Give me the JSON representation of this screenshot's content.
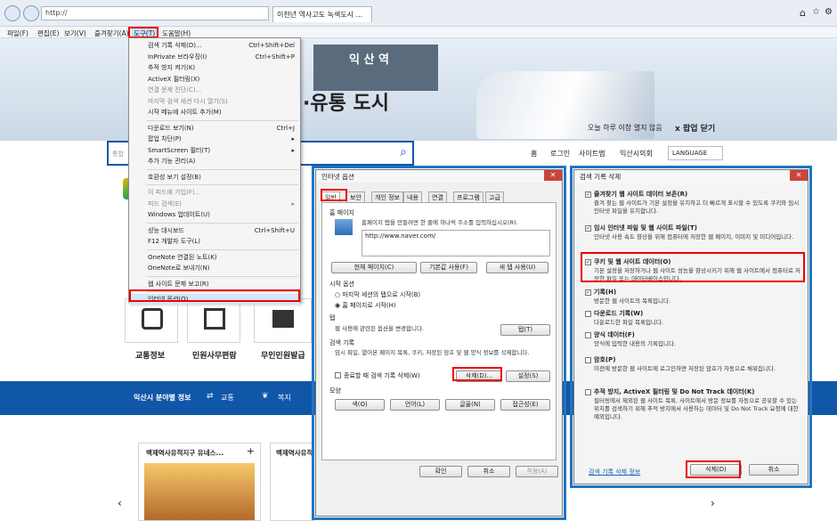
{
  "browser": {
    "address": "http://",
    "tab_title": "이천년 역사고도 녹색도시 ...",
    "menu": [
      "파일(F)",
      "편집(E)",
      "보기(V)",
      "즐겨찾기(A)",
      "도구(T)",
      "도움말(H)"
    ]
  },
  "tools_menu": {
    "items": [
      {
        "label": "검색 기록 삭제(D)...",
        "shortcut": "Ctrl+Shift+Del"
      },
      {
        "label": "InPrivate 브라우징(I)",
        "shortcut": "Ctrl+Shift+P"
      },
      {
        "label": "추적 방지 켜기(K)",
        "shortcut": ""
      },
      {
        "label": "ActiveX 필터링(X)",
        "shortcut": ""
      },
      {
        "label": "연결 문제 진단(C)...",
        "shortcut": ""
      },
      {
        "label": "마지막 검색 세션 다시 열기(S)",
        "shortcut": ""
      },
      {
        "label": "시작 메뉴에 사이트 추가(M)",
        "shortcut": ""
      },
      {
        "label": "다운로드 보기(N)",
        "shortcut": "Ctrl+J"
      },
      {
        "label": "팝업 차단(P)",
        "shortcut": "▸"
      },
      {
        "label": "SmartScreen 필터(T)",
        "shortcut": "▸"
      },
      {
        "label": "추가 기능 관리(A)",
        "shortcut": ""
      },
      {
        "label": "호환성 보기 설정(B)",
        "shortcut": ""
      },
      {
        "label": "이 피드에 가입(F)...",
        "shortcut": ""
      },
      {
        "label": "피드 검색(E)",
        "shortcut": "▸"
      },
      {
        "label": "Windows 업데이트(U)",
        "shortcut": ""
      },
      {
        "label": "성능 대시보드",
        "shortcut": "Ctrl+Shift+U"
      },
      {
        "label": "F12 개발자 도구(L)",
        "shortcut": ""
      },
      {
        "label": "OneNote 연결된 노트(K)",
        "shortcut": ""
      },
      {
        "label": "OneNote로 보내기(N)",
        "shortcut": ""
      },
      {
        "label": "웹 사이트 문제 보고(R)",
        "shortcut": ""
      },
      {
        "label": "인터넷 옵션(O)",
        "shortcut": ""
      }
    ]
  },
  "site": {
    "station_name": "익 산 역",
    "banner_text": "·유통 도시",
    "search_placeholder": "통합",
    "popup_option": "오늘 하루 이창 열지 않음",
    "popup_close": "x 팝업 닫기",
    "topnav": [
      "홈",
      "로그인",
      "사이트맵",
      "익산시의회"
    ],
    "language": "LANGUAGE",
    "quick_links": [
      "교통정보",
      "민원사무편람",
      "무인민원발급"
    ],
    "band_title": "익산시 분야별 정보",
    "band_items": [
      "교통",
      "복지"
    ],
    "card_titles": [
      "백제역사유적지구 유네스...",
      "백제역사유적지구 유네스..."
    ]
  },
  "internet_options": {
    "title": "인터넷 옵션",
    "tabs": [
      "일반",
      "보안",
      "개인 정보",
      "내용",
      "연결",
      "프로그램",
      "고급"
    ],
    "home_section": "홈 페이지",
    "home_desc": "홈페이지 탭을 만들려면 한 줄에 하나씩 주소를 입력하십시오(R).",
    "home_url": "http://www.naver.com/",
    "home_buttons": [
      "현재 페이지(C)",
      "기본값 사용(F)",
      "새 탭 사용(U)"
    ],
    "startup_section": "시작 옵션",
    "startup_options": [
      "마지막 세션의 탭으로 시작(B)",
      "홈 페이지로 시작(H)"
    ],
    "tabs_section": "탭",
    "tabs_desc": "웹 사용에 관련된 옵션을 변경합니다.",
    "tabs_button": "탭(T)",
    "history_section": "검색 기록",
    "history_desc": "임시 파일, 열어본 페이지 목록, 쿠키, 저장된 암호 및 웹 양식 정보를 삭제합니다.",
    "history_checkbox": "종료할 때 검색 기록 삭제(W)",
    "history_delete": "삭제(D)...",
    "history_settings": "설정(S)",
    "appearance_section": "모양",
    "appearance_buttons": [
      "색(O)",
      "언어(L)",
      "글꼴(N)",
      "접근성(E)"
    ],
    "footer": [
      "확인",
      "취소",
      "적용(A)"
    ]
  },
  "delete_history": {
    "title": "검색 기록 삭제",
    "items": [
      {
        "checked": true,
        "label": "즐겨찾기 웹 사이트 데이터 보존(R)",
        "desc": "즐겨 찾는 웹 사이트가 기본 설정을 유지하고 더 빠르게 표시할 수 있도록 쿠키와 임시 인터넷 파일을 유지합니다."
      },
      {
        "checked": true,
        "label": "임시 인터넷 파일 및 웹 사이트 파일(T)",
        "desc": "인터넷 사용 속도 향상을 위해 컴퓨터에 저장한 웹 페이지, 이미지 및 미디어입니다."
      },
      {
        "checked": true,
        "label": "쿠키 및 웹 사이트 데이터(O)",
        "desc": "기본 설정을 저장하거나 웹 사이트 성능을 향상시키기 위해 웹 사이트에서 컴퓨터로 저장한 파일 또는 데이터베이스입니다."
      },
      {
        "checked": true,
        "label": "기록(H)",
        "desc": "방문한 웹 사이트의 목록입니다."
      },
      {
        "checked": false,
        "label": "다운로드 기록(W)",
        "desc": "다운로드한 파일 목록입니다."
      },
      {
        "checked": false,
        "label": "양식 데이터(F)",
        "desc": "양식에 입력한 내용의 기록입니다."
      },
      {
        "checked": false,
        "label": "암호(P)",
        "desc": "이전에 방문한 웹 사이트에 로그인하면 저장된 암호가 자동으로 채워집니다."
      },
      {
        "checked": false,
        "label": "추적 방지, ActiveX 필터링 및 Do Not Track 데이터(K)",
        "desc": "필터링에서 제외된 웹 사이트 목록, 사이트에서 방문 정보를 자동으로 공유할 수 있는 위치를 검색하기 위해 추적 방지에서 사용하는 데이터 및 Do Not Track 요청에 대한 예외입니다."
      }
    ],
    "link": "검색 기록 삭제 정보",
    "delete_button": "삭제(D)",
    "cancel_button": "취소"
  },
  "colors": {
    "highlight": "#e00000",
    "frame": "#1f76c3",
    "site_blue": "#1057a8"
  }
}
